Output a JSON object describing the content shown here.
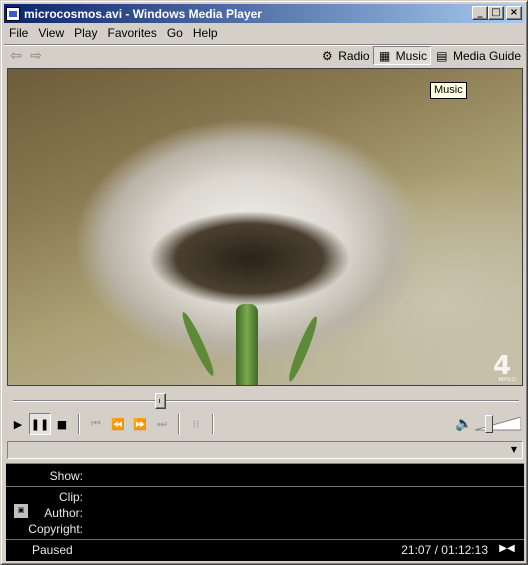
{
  "window": {
    "title": "microcosmos.avi - Windows Media Player"
  },
  "title_buttons": {
    "minimize": "_",
    "maximize": "□",
    "close": "×"
  },
  "menu": [
    {
      "label": "File"
    },
    {
      "label": "View"
    },
    {
      "label": "Play"
    },
    {
      "label": "Favorites"
    },
    {
      "label": "Go"
    },
    {
      "label": "Help"
    }
  ],
  "toolbar": {
    "back_icon": "back-arrow-icon",
    "forward_icon": "forward-arrow-icon",
    "radio_label": "Radio",
    "music_label": "Music",
    "media_guide_label": "Media Guide"
  },
  "video": {
    "tooltip": "Music",
    "logo_mark": "4",
    "logo_sub": "MPEG"
  },
  "playback": {
    "position_fraction": 0.29,
    "volume_fraction": 0.25,
    "state": "paused"
  },
  "info": {
    "show_label": "Show:",
    "show_value": "",
    "clip_label": "Clip:",
    "clip_value": "",
    "author_label": "Author:",
    "author_value": "",
    "copyright_label": "Copyright:",
    "copyright_value": "",
    "status": "Paused",
    "time": "21:07 / 01:12:13"
  },
  "colors": {
    "title_start": "#0a246a",
    "title_end": "#a6caf0",
    "face": "#d4d0c8",
    "info_bg": "#000000"
  }
}
